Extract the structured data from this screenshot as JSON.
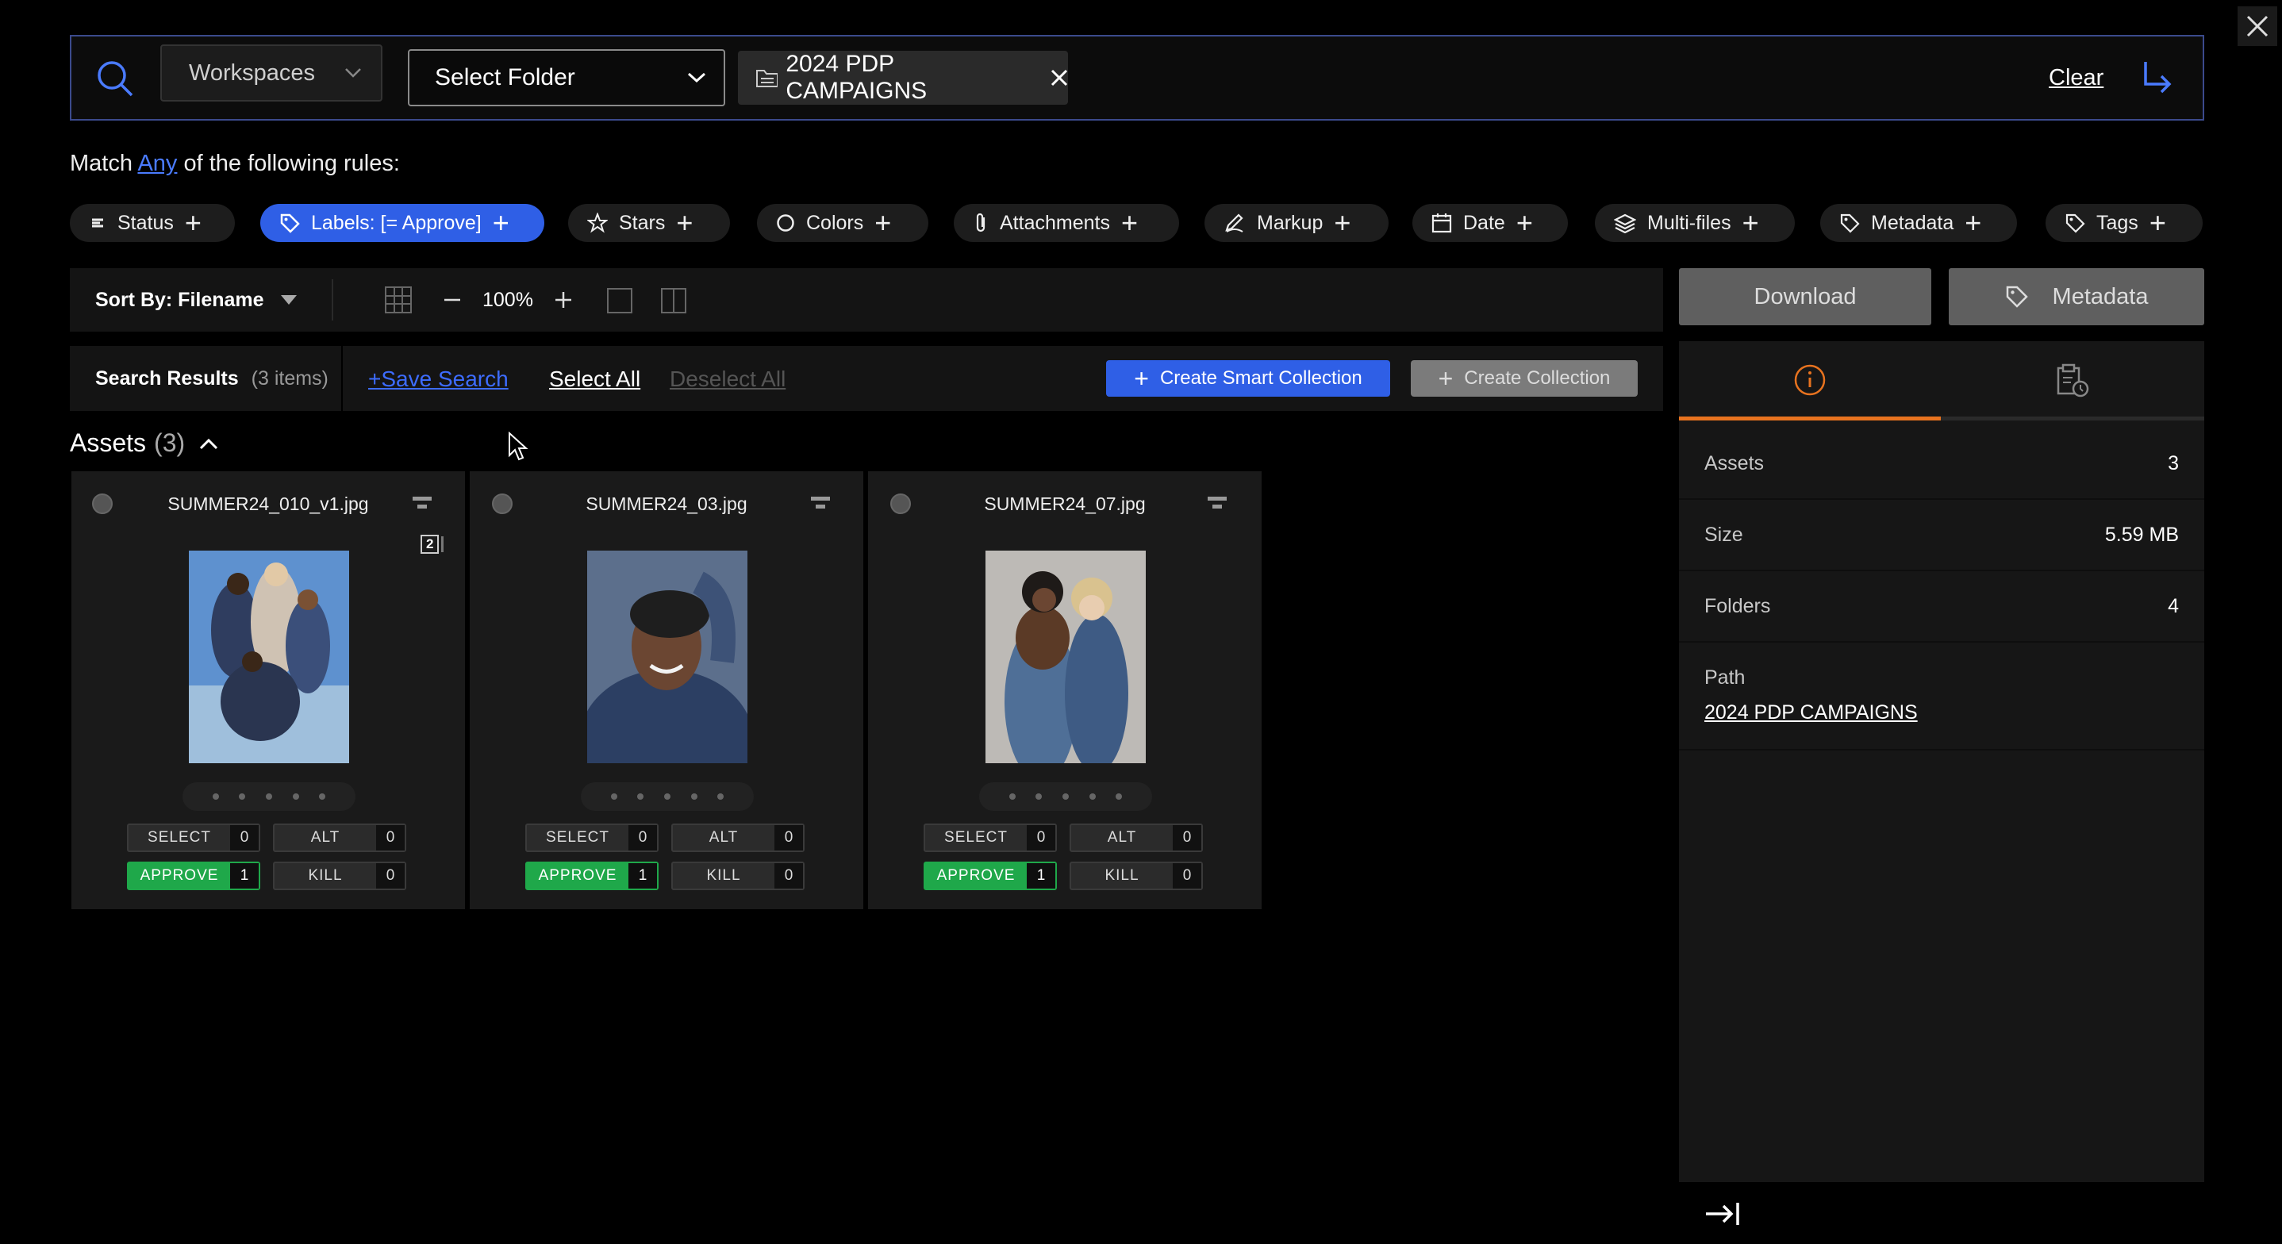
{
  "search": {
    "workspace_label": "Workspaces",
    "folder_label": "Select Folder",
    "chip_label": "2024 PDP CAMPAIGNS",
    "clear_label": "Clear"
  },
  "rules": {
    "prefix": "Match",
    "any": "Any",
    "suffix": "of the following rules:",
    "items": [
      {
        "label": "Status"
      },
      {
        "label": "Labels: [= Approve]"
      },
      {
        "label": "Stars"
      },
      {
        "label": "Colors"
      },
      {
        "label": "Attachments"
      },
      {
        "label": "Markup"
      },
      {
        "label": "Date"
      },
      {
        "label": "Multi-files"
      },
      {
        "label": "Metadata"
      },
      {
        "label": "Tags"
      }
    ]
  },
  "toolbar": {
    "sort_label": "Sort By: Filename",
    "zoom": "100%"
  },
  "results": {
    "title": "Search Results",
    "count": "(3 items)",
    "save_search": "+Save Search",
    "select_all": "Select All",
    "deselect_all": "Deselect All",
    "smart_collection": "Create Smart Collection",
    "collection": "Create Collection"
  },
  "assets_header": {
    "label": "Assets",
    "count": "(3)"
  },
  "cards": [
    {
      "filename": "SUMMER24_010_v1.jpg",
      "badge": "2",
      "select": "SELECT",
      "select_count": "0",
      "alt": "ALT",
      "alt_count": "0",
      "approve": "APPROVE",
      "approve_count": "1",
      "kill": "KILL",
      "kill_count": "0"
    },
    {
      "filename": "SUMMER24_03.jpg",
      "select": "SELECT",
      "select_count": "0",
      "alt": "ALT",
      "alt_count": "0",
      "approve": "APPROVE",
      "approve_count": "1",
      "kill": "KILL",
      "kill_count": "0"
    },
    {
      "filename": "SUMMER24_07.jpg",
      "select": "SELECT",
      "select_count": "0",
      "alt": "ALT",
      "alt_count": "0",
      "approve": "APPROVE",
      "approve_count": "1",
      "kill": "KILL",
      "kill_count": "0"
    }
  ],
  "panel": {
    "download": "Download",
    "metadata": "Metadata",
    "rows": [
      {
        "label": "Assets",
        "value": "3"
      },
      {
        "label": "Size",
        "value": "5.59 MB"
      },
      {
        "label": "Folders",
        "value": "4"
      }
    ],
    "path_label": "Path",
    "path_value": "2024 PDP CAMPAIGNS"
  },
  "colors": {
    "accent_blue": "#2f5fe6",
    "approve_green": "#1fa84a",
    "tab_orange": "#e8731f"
  }
}
